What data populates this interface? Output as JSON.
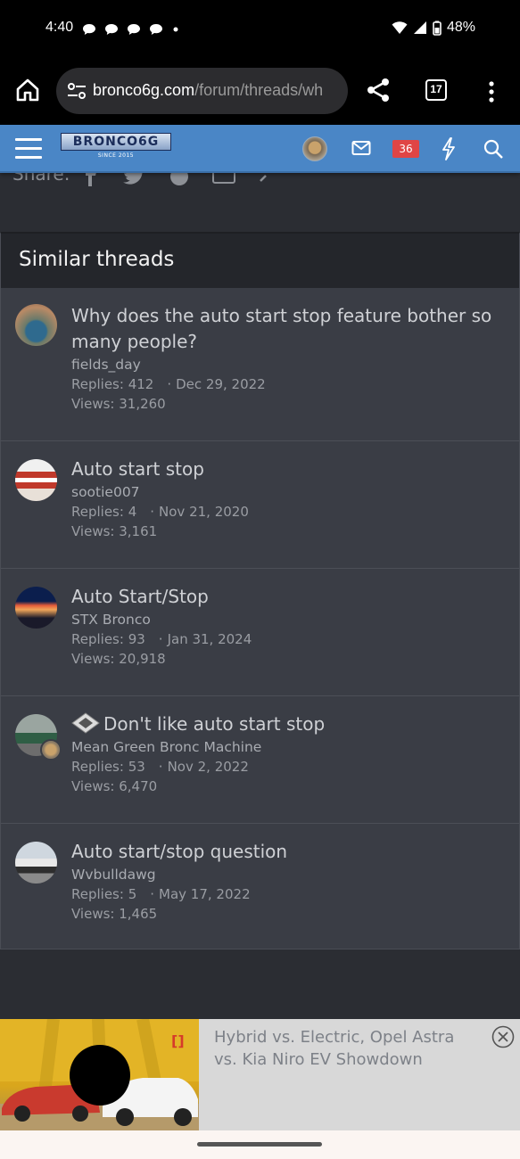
{
  "status_bar": {
    "time": "4:40",
    "battery": "48%"
  },
  "browser": {
    "url_host": "bronco6g.com",
    "url_path": "/forum/threads/wh",
    "tab_count": "17"
  },
  "header": {
    "logo_text": "BRONCO6G",
    "logo_sub": "SINCE 2015",
    "alerts_badge": "36",
    "accent_color": "#4a86c6"
  },
  "share": {
    "label": "Share:"
  },
  "similar_threads": {
    "heading": "Similar threads",
    "threads": [
      {
        "title": "Why does the auto start stop feature bother so many people?",
        "author": "fields_day",
        "replies": "Replies: 412",
        "date": "Dec 29, 2022",
        "views": "Views: 31,260"
      },
      {
        "title": "Auto start stop",
        "author": "sootie007",
        "replies": "Replies: 4",
        "date": "Nov 21, 2020",
        "views": "Views: 3,161"
      },
      {
        "title": "Auto Start/Stop",
        "author": "STX Bronco",
        "replies": "Replies: 93",
        "date": "Jan 31, 2024",
        "views": "Views: 20,918"
      },
      {
        "title": "Don't like auto start stop",
        "author": "Mean Green Bronc Machine",
        "replies": "Replies: 53",
        "date": "Nov 2, 2022",
        "views": "Views: 6,470"
      },
      {
        "title": "Auto start/stop question",
        "author": "Wvbulldawg",
        "replies": "Replies: 5",
        "date": "May 17, 2022",
        "views": "Views: 1,465"
      }
    ]
  },
  "ad": {
    "headline": "Hybrid vs. Electric, Opel Astra vs. Kia Niro EV Showdown"
  }
}
